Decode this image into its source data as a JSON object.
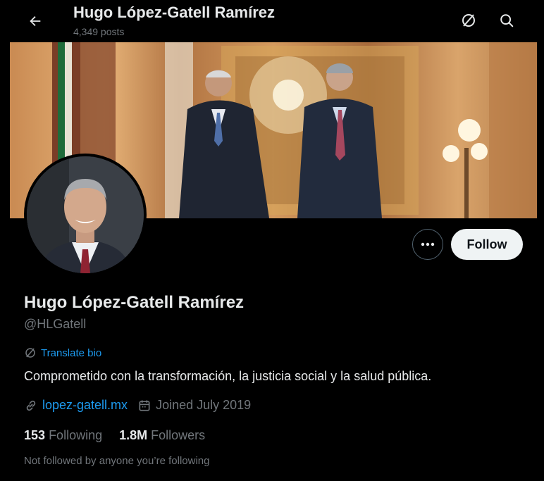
{
  "header": {
    "title": "Hugo López-Gatell Ramírez",
    "posts": "4,349 posts",
    "back_icon": "arrow-left-icon",
    "translate_icon": "translate-icon",
    "search_icon": "search-icon"
  },
  "profile": {
    "name": "Hugo López-Gatell Ramírez",
    "handle": "@HLGatell",
    "translate_bio": "Translate bio",
    "bio": "Comprometido con la transformación, la justicia social y la salud pública.",
    "website": "lopez-gatell.mx",
    "joined": "Joined July 2019",
    "following_count": "153",
    "following_label": "Following",
    "followers_count": "1.8M",
    "followers_label": "Followers",
    "not_followed": "Not followed by anyone you’re following"
  },
  "actions": {
    "follow": "Follow",
    "more_icon": "more-icon"
  },
  "colors": {
    "background": "#000000",
    "text": "#e7e9ea",
    "secondary": "#71767b",
    "accent": "#1d9bf0",
    "follow_bg": "#eff3f4"
  }
}
